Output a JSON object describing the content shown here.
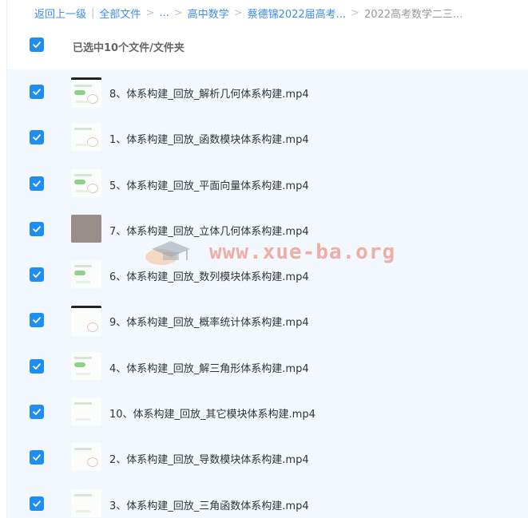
{
  "breadcrumb": {
    "back": "返回上一级",
    "all_files": "全部文件",
    "ellipsis": "...",
    "level1": "高中数学",
    "level2": "蔡德锦2022届高考...",
    "current": "2022高考数学二三..."
  },
  "header": {
    "selection_label": "已选中10个文件/文件夹"
  },
  "files": [
    {
      "name": "8、体系构建_回放_解析几何体系构建.mp4"
    },
    {
      "name": "1、体系构建_回放_函数模块体系构建.mp4"
    },
    {
      "name": "5、体系构建_回放_平面向量体系构建.mp4"
    },
    {
      "name": "7、体系构建_回放_立体几何体系构建.mp4"
    },
    {
      "name": "6、体系构建_回放_数列模块体系构建.mp4"
    },
    {
      "name": "9、体系构建_回放_概率统计体系构建.mp4"
    },
    {
      "name": "4、体系构建_回放_解三角形体系构建.mp4"
    },
    {
      "name": "10、体系构建_回放_其它模块体系构建.mp4"
    },
    {
      "name": "2、体系构建_回放_导数模块体系构建.mp4"
    },
    {
      "name": "3、体系构建_回放_三角函数体系构建.mp4"
    }
  ],
  "watermark": {
    "text": "www.xue-ba.org"
  },
  "colors": {
    "accent": "#1f8ef1",
    "link": "#3b8cf5",
    "list_background": "#f2f8fe"
  }
}
